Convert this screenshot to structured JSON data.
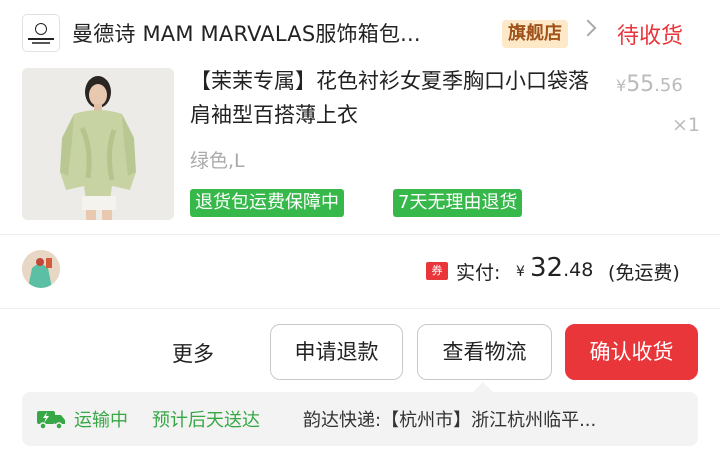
{
  "shop": {
    "name": "曼德诗 MAM MARVALAS服饰箱包...",
    "badge": "旗舰店",
    "order_status": "待收货"
  },
  "product": {
    "title": "【茉茉专属】花色衬衫女夏季胸口小口袋落肩袖型百搭薄上衣",
    "price_currency": "¥",
    "price_int": "55",
    "price_dec": ".56",
    "quantity": "×1",
    "variant": "绿色,L",
    "tags": [
      "退货包运费保障中",
      "7天无理由退货"
    ]
  },
  "payment": {
    "coupon_icon": "券",
    "label": "实付:",
    "currency": "¥",
    "amount_int": "32",
    "amount_dec": ".48",
    "shipping_note": "(免运费)"
  },
  "actions": {
    "more": "更多",
    "refund": "申请退款",
    "logistics": "查看物流",
    "confirm": "确认收货"
  },
  "logistics": {
    "icon": "truck-icon",
    "status": "运输中",
    "eta": "预计后天送达",
    "detail": "韵达快递:【杭州市】浙江杭州临平..."
  },
  "colors": {
    "accent_red": "#e8363a",
    "green": "#37b84b",
    "badge_bg": "#fde8c8",
    "badge_text": "#a0521b"
  }
}
